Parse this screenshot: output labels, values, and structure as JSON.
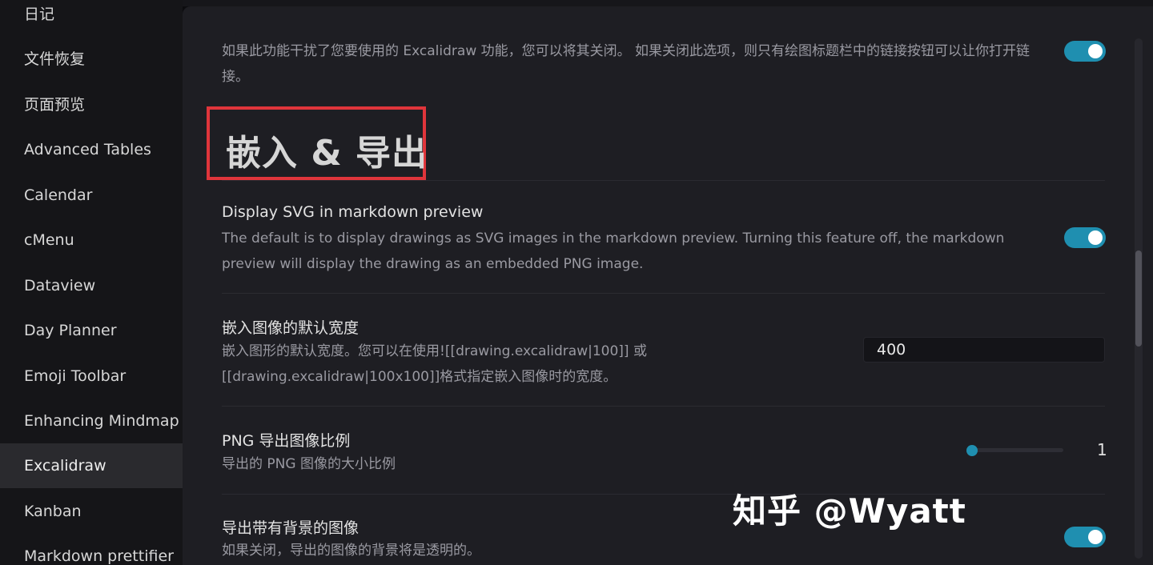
{
  "sidebar": {
    "items": [
      {
        "label": "日记"
      },
      {
        "label": "文件恢复"
      },
      {
        "label": "页面预览"
      },
      {
        "label": "Advanced Tables"
      },
      {
        "label": "Calendar"
      },
      {
        "label": "cMenu"
      },
      {
        "label": "Dataview"
      },
      {
        "label": "Day Planner"
      },
      {
        "label": "Emoji Toolbar"
      },
      {
        "label": "Enhancing Mindmap"
      },
      {
        "label": "Excalidraw"
      },
      {
        "label": "Kanban"
      },
      {
        "label": "Markdown prettifier"
      }
    ],
    "active": "Excalidraw"
  },
  "settings": {
    "link_toggle": {
      "description": "如果此功能干扰了您要使用的 Excalidraw 功能，您可以将其关闭。 如果关闭此选项，则只有绘图标题栏中的链接按钮可以让你打开链接。",
      "enabled": true
    },
    "section_heading": "嵌入 & 导出",
    "display_svg": {
      "name": "Display SVG in markdown preview",
      "description": "The default is to display drawings as SVG images in the markdown preview. Turning this feature off, the markdown preview will display the drawing as an embedded PNG image.",
      "enabled": true
    },
    "embed_width": {
      "name": "嵌入图像的默认宽度",
      "description": "嵌入图形的默认宽度。您可以在使用![[drawing.excalidraw|100]] 或 [[drawing.excalidraw|100x100]]格式指定嵌入图像时的宽度。",
      "value": "400"
    },
    "png_scale": {
      "name": "PNG 导出图像比例",
      "description": "导出的 PNG 图像的大小比例",
      "value": "1",
      "level": 0
    },
    "export_background": {
      "name": "导出带有背景的图像",
      "description": "如果关闭，导出的图像的背景将是透明的。",
      "enabled": true
    }
  },
  "watermark": "知乎 @Wyatt",
  "colors": {
    "accent": "#1f8fb0",
    "highlight_box": "#e0353b",
    "background": "#1e1e23",
    "sidebar": "#151518"
  }
}
